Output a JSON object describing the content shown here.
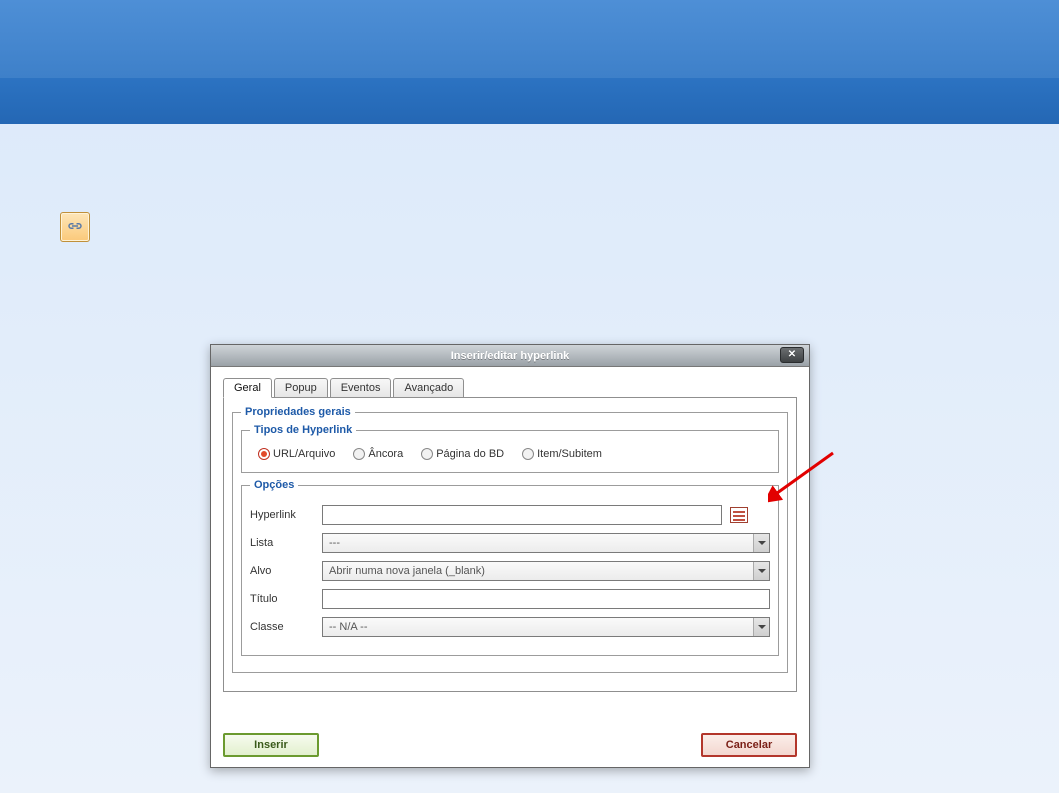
{
  "dialog": {
    "title": "Inserir/editar hyperlink",
    "tabs": [
      "Geral",
      "Popup",
      "Eventos",
      "Avançado"
    ],
    "activeTab": 0,
    "fieldset_general_legend": "Propriedades gerais",
    "fieldset_types_legend": "Tipos de Hyperlink",
    "fieldset_options_legend": "Opções",
    "radios": {
      "url_arquivo": "URL/Arquivo",
      "ancora": "Âncora",
      "pagina_bd": "Página do BD",
      "item_subitem": "Item/Subitem",
      "selected": "url_arquivo"
    },
    "fields": {
      "hyperlink_label": "Hyperlink",
      "hyperlink_value": "",
      "lista_label": "Lista",
      "lista_value": "---",
      "alvo_label": "Alvo",
      "alvo_value": "Abrir numa nova janela (_blank)",
      "titulo_label": "Título",
      "titulo_value": "",
      "classe_label": "Classe",
      "classe_value": "-- N/A --"
    },
    "buttons": {
      "insert": "Inserir",
      "cancel": "Cancelar"
    }
  }
}
